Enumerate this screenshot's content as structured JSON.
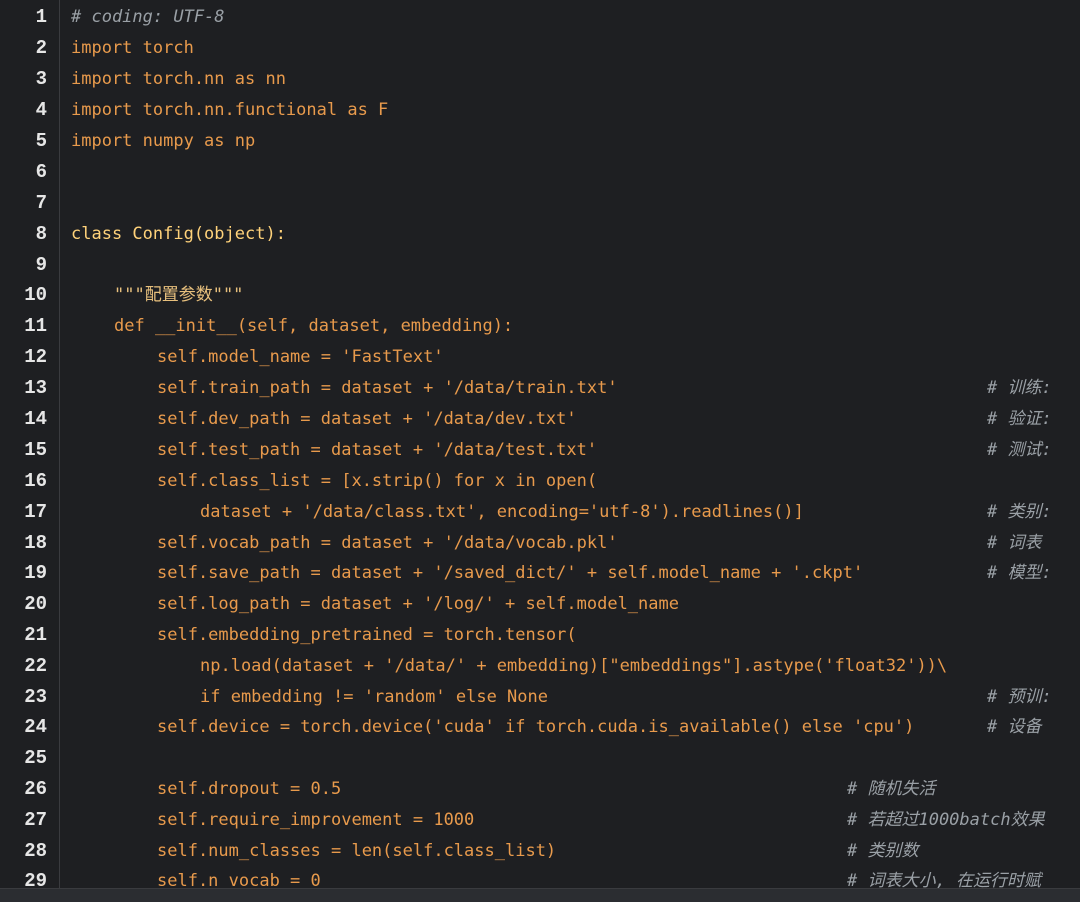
{
  "editor": {
    "line_numbers": [
      "1",
      "2",
      "3",
      "4",
      "5",
      "6",
      "7",
      "8",
      "9",
      "10",
      "11",
      "12",
      "13",
      "14",
      "15",
      "16",
      "17",
      "18",
      "19",
      "20",
      "21",
      "22",
      "23",
      "24",
      "25",
      "26",
      "27",
      "28",
      "29"
    ],
    "lines": {
      "l1": "# coding: UTF-8",
      "l2": "import torch",
      "l3": "import torch.nn as nn",
      "l4": "import torch.nn.functional as F",
      "l5": "import numpy as np",
      "l8": "class Config(object):",
      "l10": "\"\"\"配置参数\"\"\"",
      "l11": "def __init__(self, dataset, embedding):",
      "l12": "self.model_name = 'FastText'",
      "l13": "self.train_path = dataset + '/data/train.txt'",
      "l14": "self.dev_path = dataset + '/data/dev.txt'",
      "l15": "self.test_path = dataset + '/data/test.txt'",
      "l16": "self.class_list = [x.strip() for x in open(",
      "l17": "dataset + '/data/class.txt', encoding='utf-8').readlines()]",
      "l18": "self.vocab_path = dataset + '/data/vocab.pkl'",
      "l19": "self.save_path = dataset + '/saved_dict/' + self.model_name + '.ckpt'",
      "l20": "self.log_path = dataset + '/log/' + self.model_name",
      "l21": "self.embedding_pretrained = torch.tensor(",
      "l22": "np.load(dataset + '/data/' + embedding)[\"embeddings\"].astype('float32'))\\",
      "l23": "if embedding != 'random' else None",
      "l24": "self.device = torch.device('cuda' if torch.cuda.is_available() else 'cpu')",
      "l26": "self.dropout = 0.5",
      "l27": "self.require_improvement = 1000",
      "l28": "self.num_classes = len(self.class_list)",
      "l29": "self.n_vocab = 0"
    },
    "comments": {
      "c13": "# 训练:",
      "c14": "# 验证:",
      "c15": "# 测试:",
      "c17": "# 类别:",
      "c18": "# 词表",
      "c19": "# 模型:",
      "c23": "# 预训:",
      "c24": "# 设备",
      "c26": "# 随机失活",
      "c27": "# 若超过1000batch效果",
      "c28": "# 类别数",
      "c29": "# 词表大小, 在运行时赋"
    }
  }
}
